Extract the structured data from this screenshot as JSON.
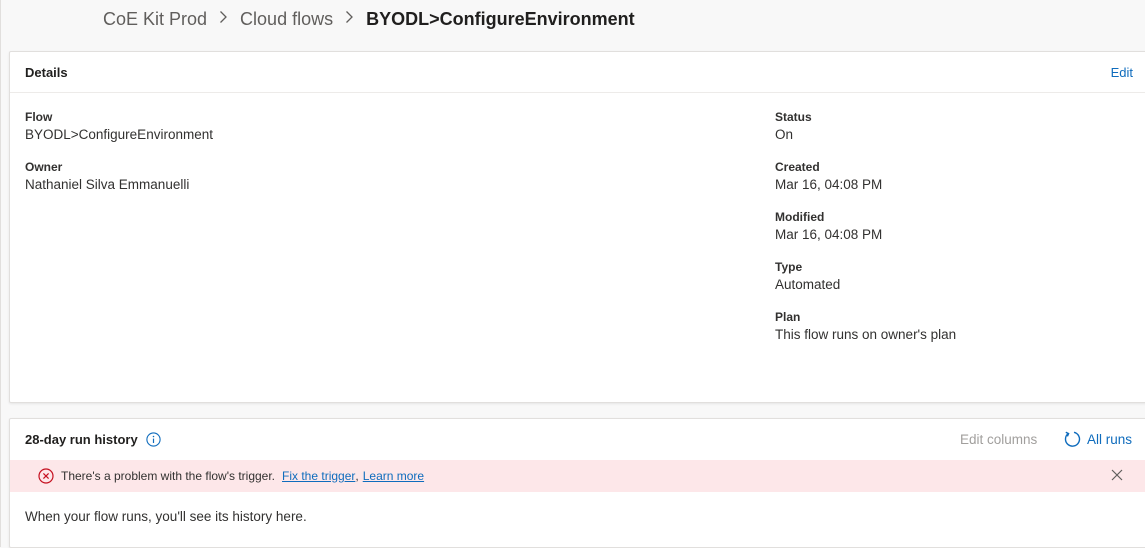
{
  "breadcrumb": {
    "items": [
      "CoE Kit Prod",
      "Cloud flows"
    ],
    "current": "BYODL>ConfigureEnvironment",
    "separator": ">"
  },
  "details": {
    "title": "Details",
    "edit_label": "Edit",
    "left_fields": [
      {
        "label": "Flow",
        "value": "BYODL>ConfigureEnvironment"
      },
      {
        "label": "Owner",
        "value": "Nathaniel Silva Emmanuelli"
      }
    ],
    "right_fields": [
      {
        "label": "Status",
        "value": "On"
      },
      {
        "label": "Created",
        "value": "Mar 16, 04:08 PM"
      },
      {
        "label": "Modified",
        "value": "Mar 16, 04:08 PM"
      },
      {
        "label": "Type",
        "value": "Automated"
      },
      {
        "label": "Plan",
        "value": "This flow runs on owner's plan"
      }
    ]
  },
  "run_history": {
    "title": "28-day run history",
    "edit_columns_label": "Edit columns",
    "all_runs_label": "All runs",
    "error": {
      "message": "There's a problem with the flow's trigger.",
      "fix_link": "Fix the trigger",
      "fix_suffix": ",",
      "learn_link": "Learn more"
    },
    "empty_message": "When your flow runs, you'll see its history here."
  },
  "colors": {
    "accent": "#0f6cbd",
    "error_bg": "#fde7e9",
    "error_icon": "#c50f1f",
    "disabled_text": "#a19f9d"
  },
  "icons": {
    "breadcrumb_separator": "chevron-right-icon",
    "info": "info-icon",
    "refresh": "refresh-icon",
    "error": "error-circle-icon",
    "close": "close-icon"
  }
}
